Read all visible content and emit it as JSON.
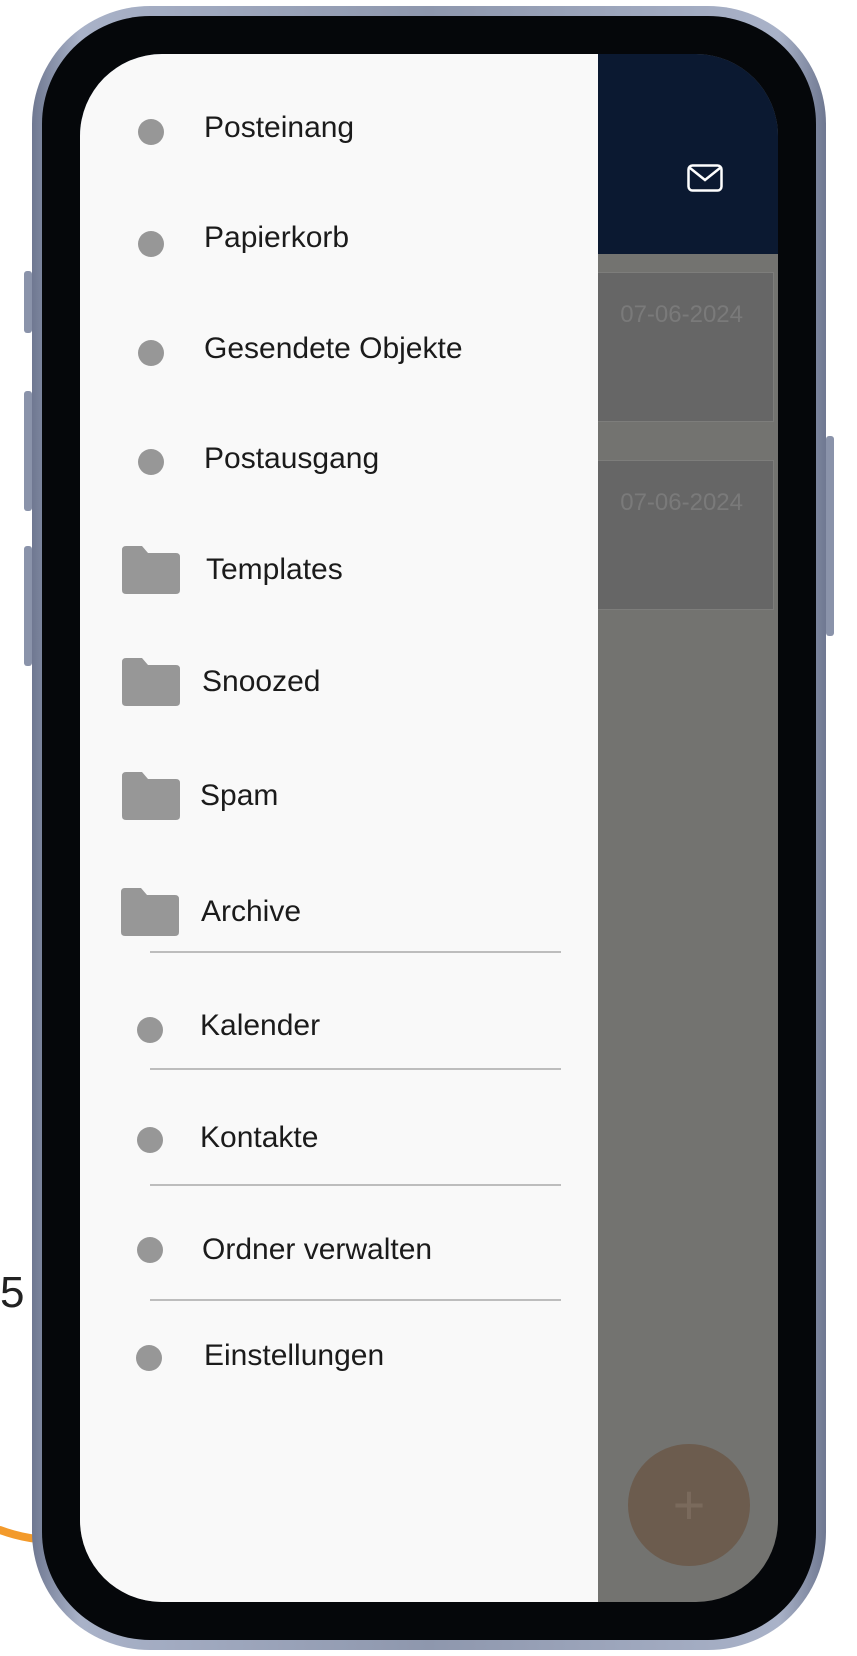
{
  "header": {
    "mail_icon": "mail-icon"
  },
  "messages": [
    {
      "date": "07-06-2024"
    },
    {
      "date": "07-06-2024"
    }
  ],
  "fab": {
    "label": "+"
  },
  "side_mark": "5",
  "drawer": {
    "items": [
      {
        "label": "Posteinang",
        "icon": "dot-icon"
      },
      {
        "label": "Papierkorb",
        "icon": "dot-icon"
      },
      {
        "label": "Gesendete Objekte",
        "icon": "dot-icon"
      },
      {
        "label": "Postausgang",
        "icon": "dot-icon"
      },
      {
        "label": "Templates",
        "icon": "folder-icon"
      },
      {
        "label": "Snoozed",
        "icon": "folder-icon"
      },
      {
        "label": "Spam",
        "icon": "folder-icon"
      },
      {
        "label": "Archive",
        "icon": "folder-icon"
      },
      {
        "label": "Kalender",
        "icon": "dot-icon"
      },
      {
        "label": "Kontakte",
        "icon": "dot-icon"
      },
      {
        "label": "Ordner verwalten",
        "icon": "dot-icon"
      },
      {
        "label": "Einstellungen",
        "icon": "dot-icon"
      }
    ]
  },
  "colors": {
    "header_bg": "#0b1931",
    "drawer_bg": "#f9f9f9",
    "icon_gray": "#979797",
    "accent_orange": "#f39a2b"
  }
}
